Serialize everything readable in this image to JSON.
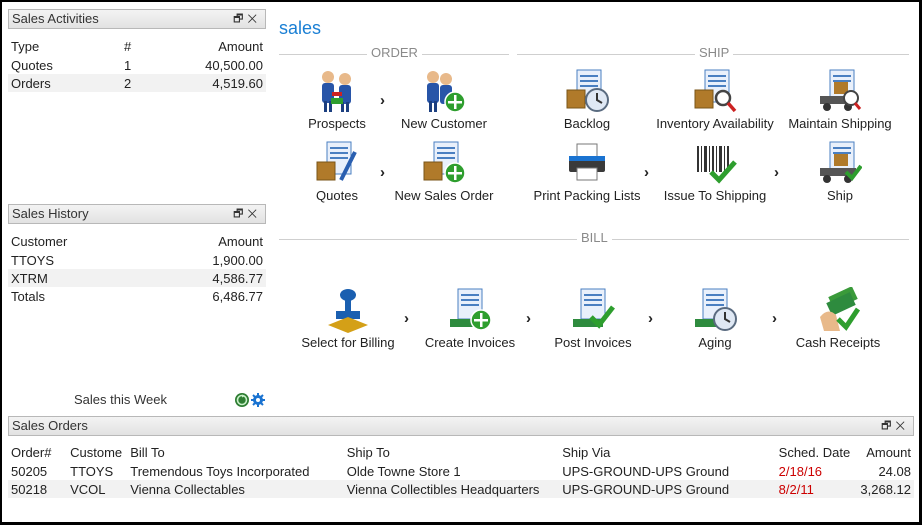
{
  "sales_activities": {
    "title": "Sales Activities",
    "headers": [
      "Type",
      "#",
      "Amount"
    ],
    "rows": [
      {
        "type": "Quotes",
        "count": "1",
        "amount": "40,500.00"
      },
      {
        "type": "Orders",
        "count": "2",
        "amount": "4,519.60"
      }
    ]
  },
  "sales_history": {
    "title": "Sales History",
    "headers": [
      "Customer",
      "Amount"
    ],
    "rows": [
      {
        "customer": "TTOYS",
        "amount": "1,900.00"
      },
      {
        "customer": "XTRM",
        "amount": "4,586.77"
      },
      {
        "customer": "Totals",
        "amount": "6,486.77"
      }
    ],
    "footer": "Sales this Week"
  },
  "flow": {
    "title": "sales",
    "sections": {
      "order": "ORDER",
      "ship": "SHIP",
      "bill": "BILL"
    },
    "nodes": {
      "prospects": "Prospects",
      "new_customer": "New Customer",
      "backlog": "Backlog",
      "inventory_availability": "Inventory Availability",
      "maintain_shipping": "Maintain Shipping",
      "quotes": "Quotes",
      "new_sales_order": "New Sales Order",
      "print_packing_lists": "Print Packing Lists",
      "issue_to_shipping": "Issue To Shipping",
      "ship": "Ship",
      "select_for_billing": "Select for Billing",
      "create_invoices": "Create Invoices",
      "post_invoices": "Post Invoices",
      "aging": "Aging",
      "cash_receipts": "Cash Receipts"
    },
    "arrow": "›"
  },
  "sales_orders": {
    "title": "Sales Orders",
    "headers": [
      "Order#",
      "Custome",
      "Bill To",
      "Ship To",
      "Ship Via",
      "Sched. Date",
      "Amount"
    ],
    "rows": [
      {
        "order": "50205",
        "customer": "TTOYS",
        "bill_to": "Tremendous Toys Incorporated",
        "ship_to": "Olde Towne Store 1",
        "ship_via": "UPS-GROUND-UPS Ground",
        "sched_date": "2/18/16",
        "amount": "24.08"
      },
      {
        "order": "50218",
        "customer": "VCOL",
        "bill_to": "Vienna Collectables",
        "ship_to": "Vienna Collectibles Headquarters",
        "ship_via": "UPS-GROUND-UPS Ground",
        "sched_date": "8/2/11",
        "amount": "3,268.12"
      }
    ]
  },
  "widget_controls": {
    "restore": "🗗",
    "close": "✕"
  },
  "colors": {
    "accent": "#1a7fd4",
    "late_date": "#cc0000",
    "doc_blue": "#4a7fc1",
    "box_brown": "#b07a2a",
    "check_green": "#2e9e2e"
  }
}
